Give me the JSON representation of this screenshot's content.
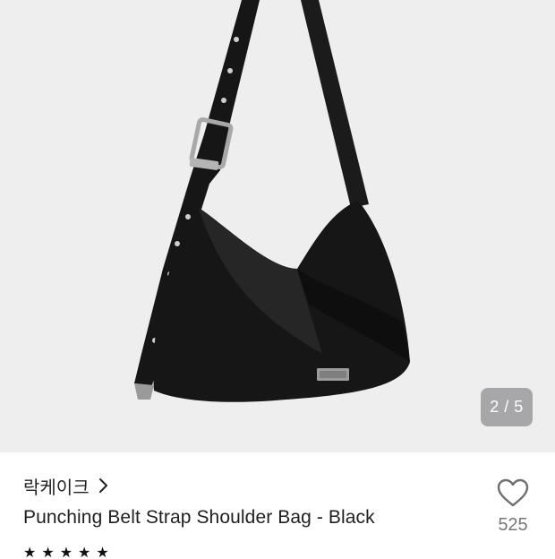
{
  "product_image": {
    "alt_icon": "shoulder-bag-image",
    "counter": {
      "current": 2,
      "total": 5,
      "text": "2 / 5"
    }
  },
  "product": {
    "brand": "락케이크",
    "title": "Punching Belt Strap Shoulder Bag - Black",
    "like_count": "525",
    "rating_stars": 5
  },
  "colors": {
    "hero_bg": "#eeeeef",
    "bag": "#151515",
    "counter_bg": "#6e6e70"
  }
}
